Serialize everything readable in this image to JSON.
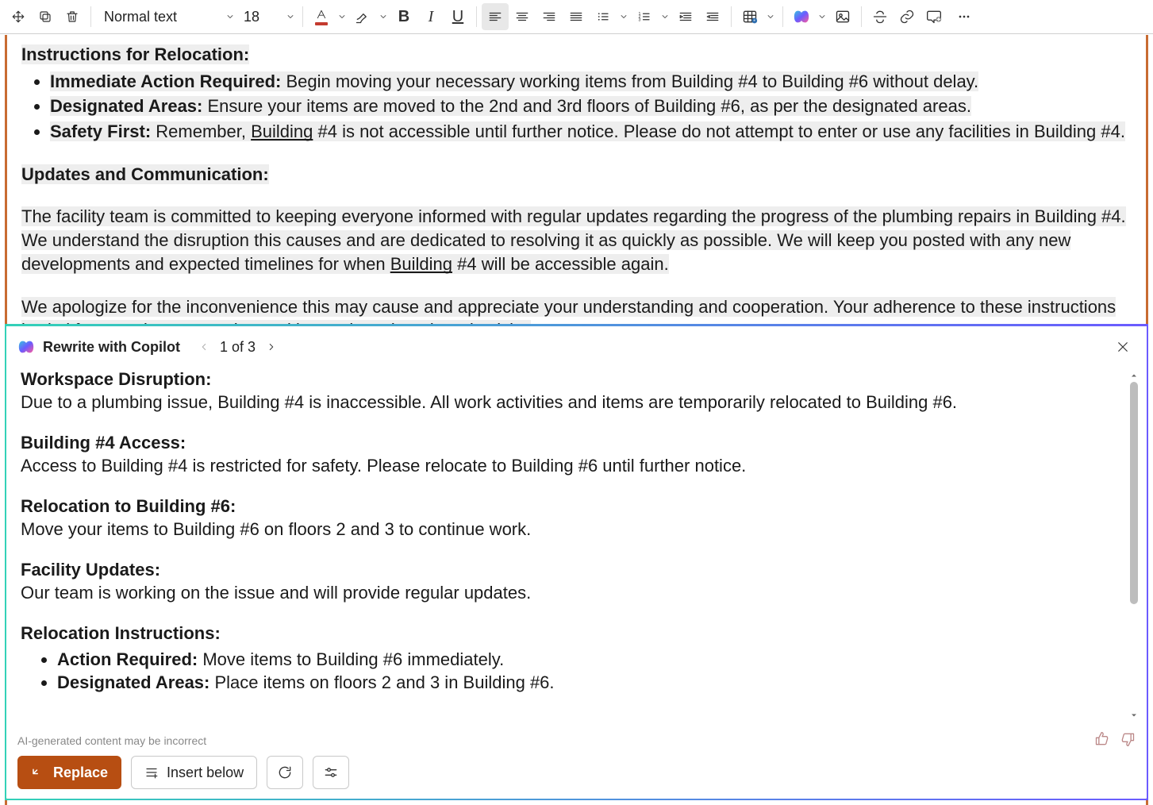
{
  "toolbar": {
    "style_label": "Normal text",
    "font_size": "18"
  },
  "document": {
    "heading1": "Instructions for Relocation:",
    "bullets1": [
      {
        "b": "Immediate Action Required:",
        "t": " Begin moving your necessary working items from Building #4 to Building #6 without delay."
      },
      {
        "b": "Designated Areas:",
        "t": " Ensure your items are moved to the 2nd and 3rd floors of Building #6, as per the designated areas."
      },
      {
        "b": "Safety First:",
        "t_pre": " Remember, ",
        "link": "Building",
        "t_post": " #4 is not accessible until further notice. Please do not attempt to enter or use any facilities in Building #4."
      }
    ],
    "heading2": "Updates and Communication:",
    "para1_a": "The facility team is committed to keeping everyone informed with regular updates regarding the progress of the plumbing repairs in Building #4. We understand the disruption this causes and are dedicated to resolving it as quickly as possible. We will keep you posted with any new developments and expected timelines for when ",
    "para1_link": "Building",
    "para1_b": " #4 will be accessible again.",
    "para2": "We apologize for the inconvenience this may cause and appreciate your understanding and cooperation. Your adherence to these instructions is vital for ensuring a smooth transition and continued productivity."
  },
  "copilot": {
    "title": "Rewrite with Copilot",
    "page": "1 of 3",
    "sections": [
      {
        "h": "Workspace Disruption:",
        "p": "Due to a plumbing issue, Building #4 is inaccessible. All work activities and items are temporarily relocated to Building #6."
      },
      {
        "h": "Building #4 Access:",
        "p": "Access to Building #4 is restricted for safety. Please relocate to Building #6 until further notice."
      },
      {
        "h": "Relocation to Building #6:",
        "p": "Move your items to Building #6 on floors 2 and 3 to continue work."
      },
      {
        "h": "Facility Updates:",
        "p": "Our team is working on the issue and will provide regular updates."
      }
    ],
    "instructions_h": "Relocation Instructions:",
    "instructions": [
      {
        "b": "Action Required:",
        "t": " Move items to Building #6 immediately."
      },
      {
        "b": "Designated Areas:",
        "t": " Place items on floors 2 and 3 in Building #6."
      }
    ],
    "disclaimer": "AI-generated content may be incorrect",
    "replace_label": "Replace",
    "insert_label": "Insert below"
  }
}
